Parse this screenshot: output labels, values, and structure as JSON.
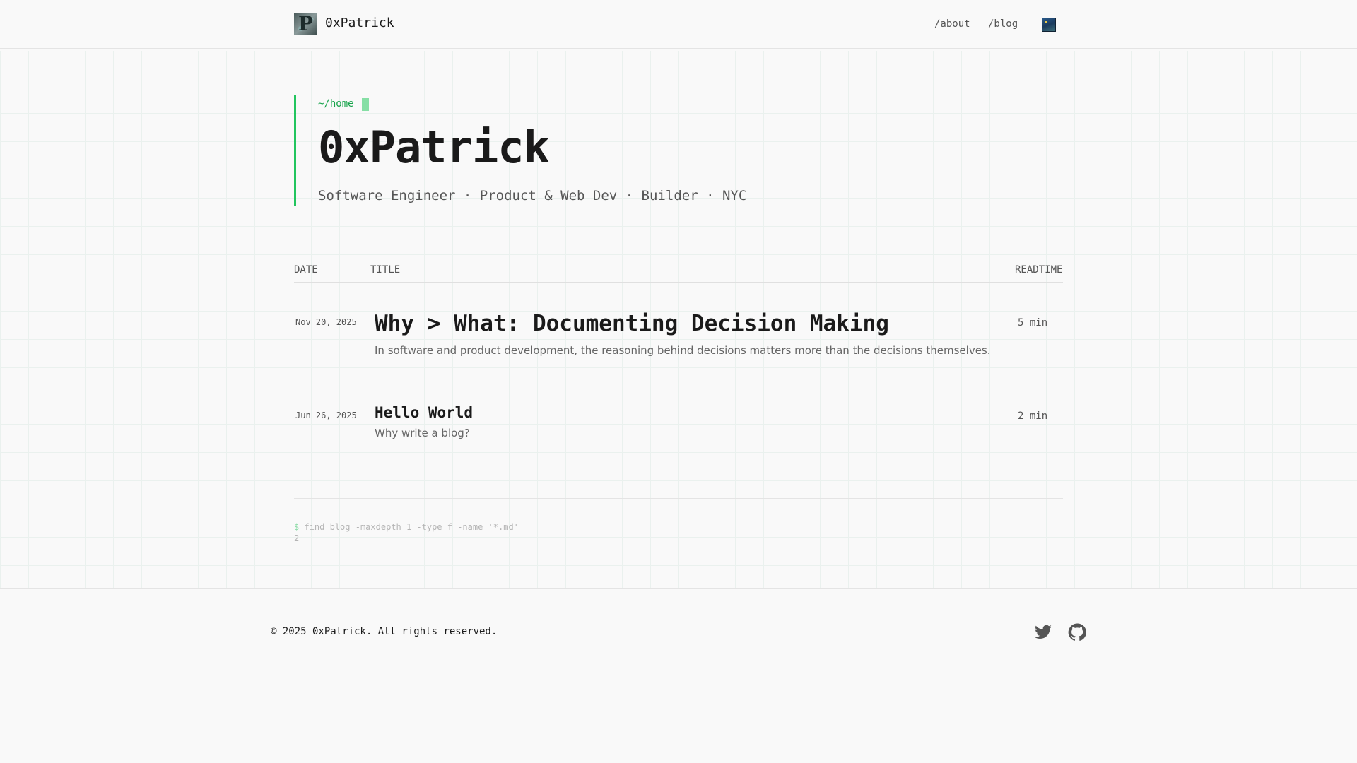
{
  "header": {
    "brand": "0xPatrick",
    "logo_letter": "P",
    "nav": [
      {
        "label": "/about"
      },
      {
        "label": "/blog"
      }
    ]
  },
  "hero": {
    "path": "~/home",
    "title": "0xPatrick",
    "subtitle": "Software Engineer · Product & Web Dev · Builder · NYC"
  },
  "table": {
    "columns": [
      "DATE",
      "TITLE",
      "READTIME"
    ],
    "rows": [
      {
        "date": "Nov 20, 2025",
        "title": "Why > What: Documenting Decision Making",
        "description": "In software and product development, the reasoning behind decisions matters more than the decisions themselves.",
        "readtime": "5 min"
      },
      {
        "date": "Jun 26, 2025",
        "title": "Hello World",
        "description": "Why write a blog?",
        "readtime": "2 min"
      }
    ]
  },
  "terminal": {
    "prompt": "$",
    "command": "find blog -maxdepth 1 -type f -name '*.md'",
    "output": "2"
  },
  "footer": {
    "copyright": "© 2025 0xPatrick. All rights reserved.",
    "icons": [
      "twitter-icon",
      "github-icon"
    ]
  },
  "colors": {
    "accent": "#22c55e",
    "text": "#1a1a1a",
    "muted": "#555555"
  }
}
